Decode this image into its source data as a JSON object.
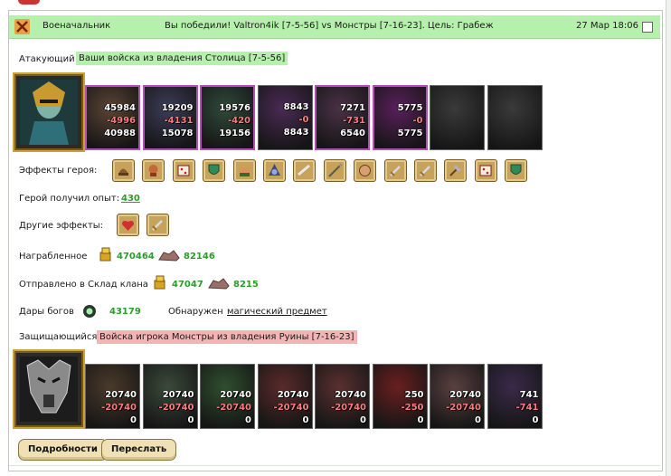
{
  "header": {
    "role": "Военачальник",
    "title": "Вы победили! Valtron4ik [7-5-56] vs Монстры [7-16-23]. Цель: Грабеж",
    "date": "27 Мар 18:06"
  },
  "attacker": {
    "label": "Атакующий",
    "tag": "Ваши войска из владения Столица [7-5-56]",
    "units": [
      {
        "a": "45984",
        "b": "-4996",
        "c": "40988",
        "color": "#5b4434",
        "sel": true
      },
      {
        "a": "19209",
        "b": "-4131",
        "c": "15078",
        "color": "#3c3c5a",
        "sel": true
      },
      {
        "a": "19576",
        "b": "-420",
        "c": "19156",
        "color": "#2f4a3a",
        "sel": true
      },
      {
        "a": "8843",
        "b": "-0",
        "c": "8843",
        "color": "#4a2a55",
        "sel": false
      },
      {
        "a": "7271",
        "b": "-731",
        "c": "6540",
        "color": "#4a3146",
        "sel": true
      },
      {
        "a": "5775",
        "b": "-0",
        "c": "5775",
        "color": "#5a1f5c",
        "sel": true
      },
      {
        "a": "",
        "b": "",
        "c": "",
        "color": "#3a3a3a",
        "sel": false
      },
      {
        "a": "",
        "b": "",
        "c": "",
        "color": "#3a3a3a",
        "sel": false
      }
    ]
  },
  "hero_effects": {
    "label": "Эффекты героя:",
    "icons": [
      "helmet-icon",
      "skull-icon",
      "dice-icon",
      "shield-icon",
      "fist-icon",
      "pentagram-icon",
      "scroll-icon",
      "spear-icon",
      "egg-icon",
      "sword-icon",
      "sword-icon",
      "axe-icon",
      "dice-icon",
      "shield-icon"
    ]
  },
  "experience": {
    "label": "Герой получил опыт:",
    "value": "430"
  },
  "other_effects": {
    "label": "Другие эффекты:",
    "icons": [
      "heart-icon",
      "sword-icon"
    ]
  },
  "loot": {
    "label": "Награбленное",
    "gold": "470464",
    "ore": "82146"
  },
  "clan": {
    "label": "Отправлено в Склад клана",
    "gold": "47047",
    "ore": "8215"
  },
  "gifts": {
    "label": "Дары богов",
    "value": "43179",
    "found_label": "Обнаружен",
    "found_link": "магический предмет"
  },
  "defender": {
    "label": "Защищающийся",
    "tag": "Войска игрока Монстры из владения Руины [7-16-23]",
    "units": [
      {
        "a": "20740",
        "b": "-20740",
        "c": "0",
        "color": "#4a3a2a"
      },
      {
        "a": "20740",
        "b": "-20740",
        "c": "0",
        "color": "#3a4a3a"
      },
      {
        "a": "20740",
        "b": "-20740",
        "c": "0",
        "color": "#2f4f2f"
      },
      {
        "a": "20740",
        "b": "-20740",
        "c": "0",
        "color": "#5a2a2a"
      },
      {
        "a": "20740",
        "b": "-20740",
        "c": "0",
        "color": "#5a3030"
      },
      {
        "a": "250",
        "b": "-250",
        "c": "0",
        "color": "#6a1f1f"
      },
      {
        "a": "20740",
        "b": "-20740",
        "c": "0",
        "color": "#5a4040"
      },
      {
        "a": "741",
        "b": "-741",
        "c": "0",
        "color": "#3a2a4a"
      }
    ]
  },
  "buttons": {
    "details": "Подробности",
    "forward": "Переслать"
  },
  "colors": {
    "header_bg": "#b6f0ad",
    "green_text": "#2a9d2a",
    "red_tag": "#f3b4b4",
    "select_border": "#b84cb8"
  }
}
